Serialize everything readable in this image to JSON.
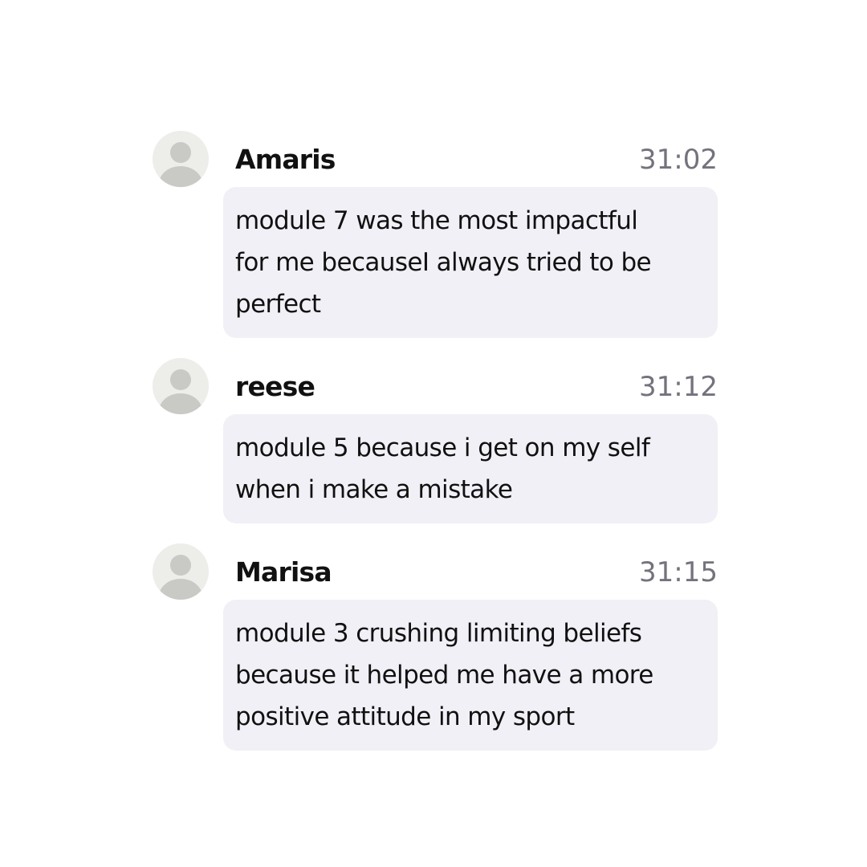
{
  "messages": [
    {
      "author": "Amaris",
      "time": "31:02",
      "lines": [
        "module 7 was the most impactful",
        "for me becauseI always tried to be",
        "perfect"
      ],
      "avatar_icon": "default-user-avatar-icon"
    },
    {
      "author": "reese",
      "time": "31:12",
      "lines": [
        "module 5 because i get on my self",
        "when i make a mistake"
      ],
      "avatar_icon": "default-user-avatar-icon"
    },
    {
      "author": "Marisa",
      "time": "31:15",
      "lines": [
        "module 3 crushing limiting beliefs",
        "because it helped me have a more",
        "positive attitude in my sport"
      ],
      "avatar_icon": "default-user-avatar-icon"
    }
  ],
  "colors": {
    "background": "#ffffff",
    "bubble": "#f1f0f6",
    "avatar_bg": "#ededea",
    "avatar_figure": "#c9c9c6",
    "timestamp": "#73737d",
    "text": "#111111"
  }
}
